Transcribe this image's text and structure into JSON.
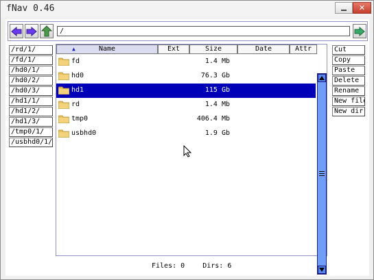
{
  "window": {
    "title": "fNav 0.46"
  },
  "path": {
    "value": "/"
  },
  "bookmarks": [
    "/rd/1/",
    "/fd/1/",
    "/hd0/1/",
    "/hd0/2/",
    "/hd0/3/",
    "/hd1/1/",
    "/hd1/2/",
    "/hd1/3/",
    "/tmp0/1/",
    "/usbhd0/1/"
  ],
  "columns": {
    "name": "Name",
    "ext": "Ext",
    "size": "Size",
    "date": "Date",
    "attr": "Attr"
  },
  "files": [
    {
      "name": "fd",
      "size": "1.4 Mb",
      "selected": false
    },
    {
      "name": "hd0",
      "size": "76.3 Gb",
      "selected": false
    },
    {
      "name": "hd1",
      "size": "115 Gb",
      "selected": true
    },
    {
      "name": "rd",
      "size": "1.4 Mb",
      "selected": false
    },
    {
      "name": "tmp0",
      "size": "406.4 Mb",
      "selected": false
    },
    {
      "name": "usbhd0",
      "size": "1.9 Gb",
      "selected": false
    }
  ],
  "actions": {
    "cut": "Cut",
    "copy": "Copy",
    "paste": "Paste",
    "delete": "Delete",
    "rename": "Rename",
    "new_file": "New file",
    "new_dir": "New dir"
  },
  "status": {
    "files": "Files: 0",
    "dirs": "Dirs: 6"
  },
  "colors": {
    "selection": "#0000b8",
    "scrollbar": "#6e9ef5",
    "nav_arrow": "#6a3cf0",
    "up_arrow": "#4a9a4a",
    "go_arrow": "#3aaa6a"
  }
}
